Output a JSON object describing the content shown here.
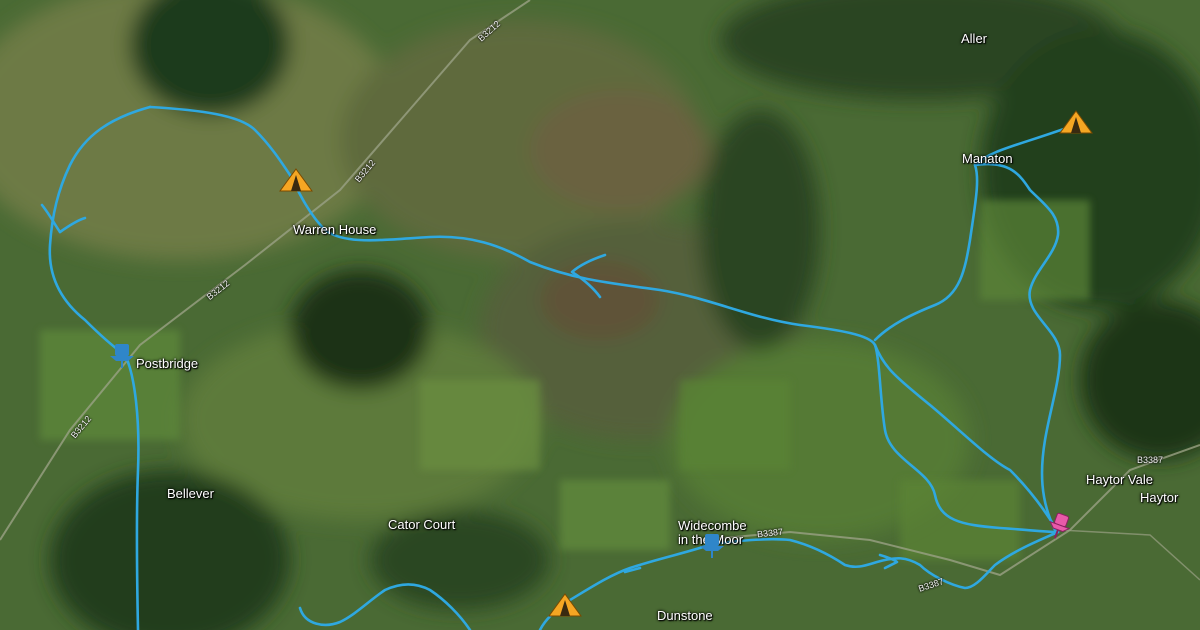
{
  "map": {
    "style": "satellite",
    "route_color": "#2fa8e0",
    "places": [
      {
        "id": "aller",
        "label": "Aller"
      },
      {
        "id": "manaton",
        "label": "Manaton"
      },
      {
        "id": "warren-house",
        "label": "Warren House"
      },
      {
        "id": "postbridge",
        "label": "Postbridge"
      },
      {
        "id": "bellever",
        "label": "Bellever"
      },
      {
        "id": "cator-court",
        "label": "Cator Court"
      },
      {
        "id": "widecombe",
        "label": "Widecombe\nin the Moor"
      },
      {
        "id": "dunstone",
        "label": "Dunstone"
      },
      {
        "id": "haytor-vale",
        "label": "Haytor Vale"
      },
      {
        "id": "haytor",
        "label": "Haytor"
      }
    ],
    "roads": [
      {
        "id": "b3212-top",
        "label": "B3212"
      },
      {
        "id": "b3212-mid",
        "label": "B3212"
      },
      {
        "id": "b3212-left",
        "label": "B3212"
      },
      {
        "id": "b3212-bottom",
        "label": "B3212"
      },
      {
        "id": "b3387-widecombe",
        "label": "B3387"
      },
      {
        "id": "b3387-bottom",
        "label": "B3387"
      },
      {
        "id": "b3387-right",
        "label": "B3387"
      }
    ],
    "markers": {
      "campsite_icon": "tent-icon",
      "campsite_color": "#f5a623",
      "waypoint_icon": "pushpin-icon",
      "waypoint_color": "#2f86c9",
      "destination_icon": "pin-icon",
      "destination_color": "#e85aa8"
    }
  }
}
